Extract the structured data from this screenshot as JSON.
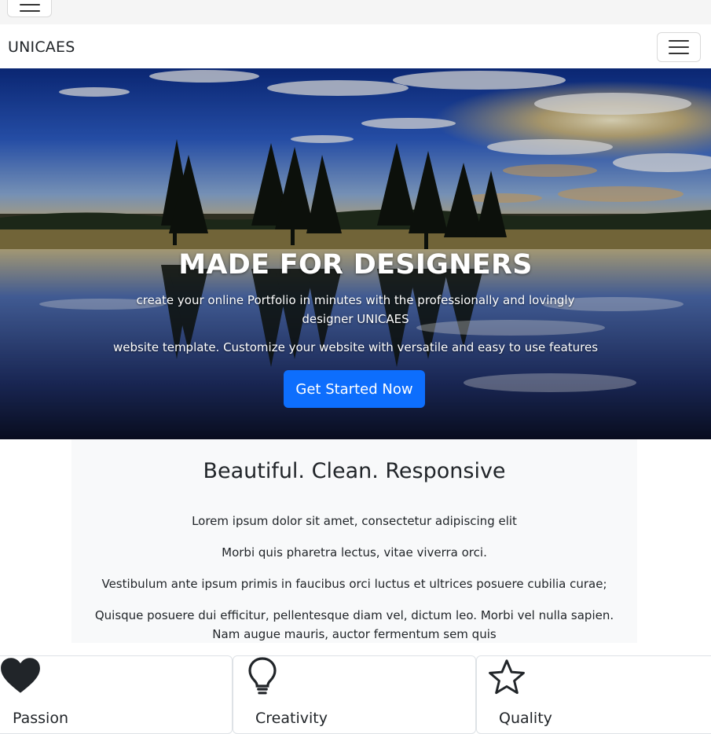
{
  "brand": "UNICAES",
  "hero": {
    "title": "MADE FOR DESIGNERS",
    "subtitle": "create your online Portfolio in minutes with the professionally and lovingly designer UNICAES",
    "subtitle2": "website template. Customize your website with versatile and easy to use features",
    "cta_label": "Get Started Now"
  },
  "features": {
    "title": "Beautiful. Clean. Responsive",
    "lines": [
      "Lorem ipsum dolor sit amet, consectetur adipiscing elit",
      "Morbi quis pharetra lectus, vitae viverra orci.",
      "Vestibulum ante ipsum primis in faucibus orci luctus et ultrices posuere cubilia curae;",
      "Quisque posuere dui efficitur, pellentesque diam vel, dictum leo. Morbi vel nulla sapien. Nam augue mauris, auctor fermentum sem quis"
    ]
  },
  "cards": [
    {
      "title": "Passion",
      "icon": "heart-icon"
    },
    {
      "title": "Creativity",
      "icon": "lightbulb-icon"
    },
    {
      "title": "Quality",
      "icon": "star-icon"
    }
  ],
  "colors": {
    "primary": "#0d6efd",
    "text": "#212529",
    "panel_bg": "#f8f9fa"
  }
}
